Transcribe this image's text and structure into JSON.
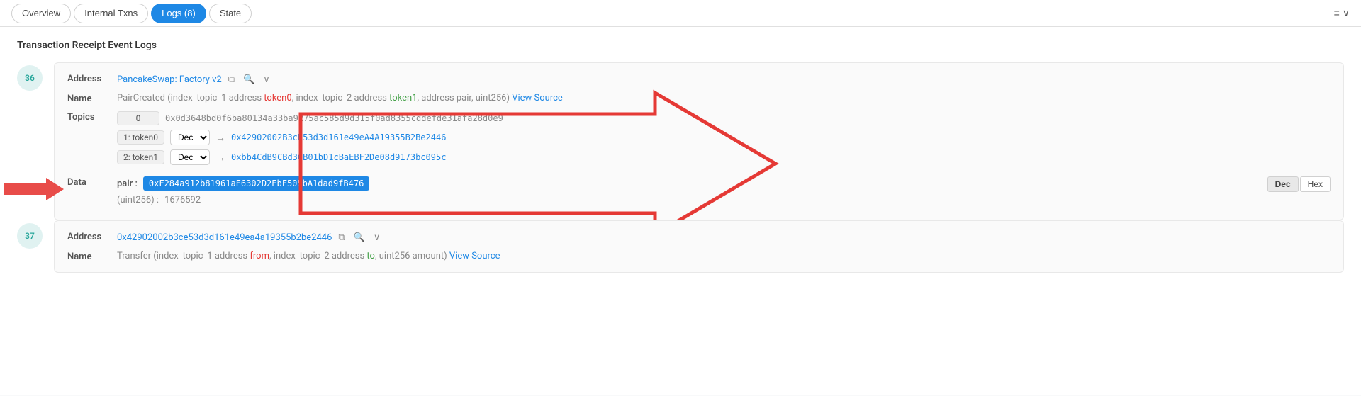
{
  "tabs": {
    "items": [
      {
        "label": "Overview",
        "id": "overview",
        "active": false
      },
      {
        "label": "Internal Txns",
        "id": "internal-txns",
        "active": false
      },
      {
        "label": "Logs (8)",
        "id": "logs",
        "active": true
      },
      {
        "label": "State",
        "id": "state",
        "active": false
      }
    ]
  },
  "toolbar_right": {
    "list_icon": "≡",
    "chevron": "∨"
  },
  "section_title": "Transaction Receipt Event Logs",
  "logs": [
    {
      "index": "36",
      "address_label": "Address",
      "address_text": "PancakeSwap: Factory v2",
      "address_href": "#",
      "name_label": "Name",
      "name_text": "PairCreated (index_topic_1 address token0, index_topic_2 address token1, address pair, uint256) View Source",
      "name_parts": {
        "prefix": "PairCreated (index_topic_1 address ",
        "token0": "token0",
        "mid1": ", index_topic_2 address ",
        "token1": "token1",
        "mid2": ", address pair, uint256) ",
        "view_source": "View Source"
      },
      "topics_label": "Topics",
      "topics": [
        {
          "index": "0",
          "value": "0x0d3648bd0f6ba80134a33ba9275ac585d9d315f0ad8355cddefde31afa28d0e9",
          "has_decode": false
        },
        {
          "index": "1: token0",
          "decode_option": "Dec",
          "arrow": "→",
          "value": "0x42902002B3cE53d3d161e49eA4A19355B2Be2446",
          "has_decode": true
        },
        {
          "index": "2: token1",
          "decode_option": "Dec",
          "arrow": "→",
          "value": "0xbb4CdB9CBd36B01bD1cBaEBF2De08d9173bc095c",
          "has_decode": true
        }
      ],
      "data_label": "Data",
      "data_fields": [
        {
          "key": "pair :",
          "value": "0xF284a912b81961aE6302D2EbF505bA1dad9fB476",
          "highlighted": true
        },
        {
          "key": "(uint256) :",
          "value": "1676592",
          "highlighted": false
        }
      ],
      "dec_hex": {
        "dec_label": "Dec",
        "hex_label": "Hex",
        "active": "dec"
      },
      "has_arrow_annotation": true
    },
    {
      "index": "37",
      "address_label": "Address",
      "address_text": "0x42902002b3ce53d3d161e49ea4a19355b2be2446",
      "address_href": "#",
      "name_label": "Name",
      "name_text": "Transfer (index_topic_1 address from, index_topic_2 address to, uint256 amount) View Source",
      "name_parts": {
        "prefix": "Transfer (index_topic_1 address ",
        "token0": "from",
        "mid1": ", index_topic_2 address ",
        "token1": "to",
        "mid2": ", uint256 amount) ",
        "view_source": "View Source"
      },
      "has_arrow_annotation": false
    }
  ]
}
